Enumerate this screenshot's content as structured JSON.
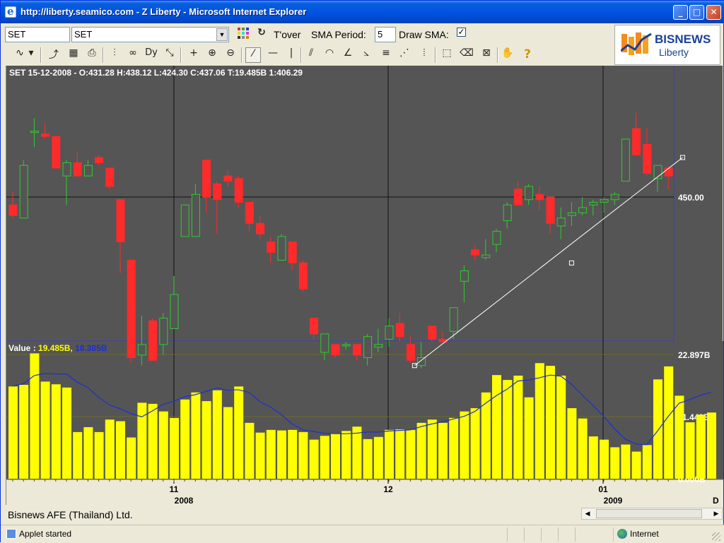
{
  "window": {
    "title": "http://liberty.seamico.com - Z Liberty - Microsoft Internet Explorer",
    "min_glyph": "_",
    "max_glyph": "□",
    "close_glyph": "✕"
  },
  "toolbar1": {
    "symbol_input": "SET",
    "symbol_select": "SET",
    "tover_label": "T'over",
    "sma_period_label": "SMA Period:",
    "sma_period_value": "5",
    "draw_sma_label": "Draw SMA:",
    "draw_sma_checked": "✓"
  },
  "toolbar2": {
    "icons": [
      {
        "name": "line-chart-icon",
        "glyph": "∿"
      },
      {
        "name": "chart-type-dropdown-icon",
        "glyph": "▾"
      },
      {
        "name": "export-icon",
        "glyph": "⤴"
      },
      {
        "name": "save-icon",
        "glyph": "▦"
      },
      {
        "name": "print-icon",
        "glyph": "⎙"
      },
      {
        "name": "indicator-icon",
        "glyph": "⫶"
      },
      {
        "name": "period-icon",
        "glyph": "∞"
      },
      {
        "name": "dy-icon",
        "glyph": "Dy"
      },
      {
        "name": "resize-icon",
        "glyph": "⤡"
      },
      {
        "name": "crosshair-icon",
        "glyph": "+"
      },
      {
        "name": "zoom-in-icon",
        "glyph": "⊕"
      },
      {
        "name": "zoom-out-icon",
        "glyph": "⊖"
      },
      {
        "name": "trend-line-icon",
        "glyph": "⁄"
      },
      {
        "name": "horizontal-line-icon",
        "glyph": "—"
      },
      {
        "name": "vertical-line-icon",
        "glyph": "|"
      },
      {
        "name": "channel-icon",
        "glyph": "⫽"
      },
      {
        "name": "arc-icon",
        "glyph": "◠"
      },
      {
        "name": "fan-icon",
        "glyph": "∠"
      },
      {
        "name": "speed-line-icon",
        "glyph": "⦣"
      },
      {
        "name": "fibonacci-icon",
        "glyph": "≡"
      },
      {
        "name": "gann-fan-icon",
        "glyph": "⋰"
      },
      {
        "name": "cycle-icon",
        "glyph": "⦙"
      },
      {
        "name": "select-icon",
        "glyph": "⬚"
      },
      {
        "name": "delete-icon",
        "glyph": "⌫"
      },
      {
        "name": "delete-all-icon",
        "glyph": "⊠"
      },
      {
        "name": "pan-hand-icon",
        "glyph": "✋"
      },
      {
        "name": "help-icon",
        "glyph": "?"
      }
    ]
  },
  "logo": {
    "text_main": "BISNEWS",
    "text_sub": "Liberty"
  },
  "chart": {
    "ohlc_label": "SET 15-12-2008 - O:431.28 H:438.12 L:424.30 C:437.06 T:19.485B 1:406.29",
    "price_axis_label": "450.00",
    "volume_label_prefix": "Value : ",
    "volume_value_1": "19.485B,",
    "volume_value_2": "18.385B",
    "volume_ticks": [
      "22.897B",
      "11.449B",
      "0.000B"
    ],
    "x_ticks": [
      {
        "month": "11",
        "year": "2008"
      },
      {
        "month": "12",
        "year": ""
      },
      {
        "month": "01",
        "year": "2009"
      }
    ],
    "x_axis_end_label": "D"
  },
  "chart_data": {
    "type": "candlestick",
    "title": "SET",
    "price_series": [
      {
        "o": 447,
        "h": 452,
        "l": 442,
        "c": 443
      },
      {
        "o": 442,
        "h": 464,
        "l": 442,
        "c": 462
      },
      {
        "o": 475,
        "h": 480,
        "l": 469,
        "c": 475
      },
      {
        "o": 474,
        "h": 478,
        "l": 472,
        "c": 473
      },
      {
        "o": 473,
        "h": 473,
        "l": 461,
        "c": 461
      },
      {
        "o": 458,
        "h": 464,
        "l": 447,
        "c": 463
      },
      {
        "o": 463,
        "h": 467,
        "l": 458,
        "c": 458
      },
      {
        "o": 458,
        "h": 464,
        "l": 458,
        "c": 462
      },
      {
        "o": 465,
        "h": 466,
        "l": 462,
        "c": 463
      },
      {
        "o": 461,
        "h": 461,
        "l": 453,
        "c": 454
      },
      {
        "o": 449,
        "h": 449,
        "l": 421,
        "c": 433
      },
      {
        "o": 426,
        "h": 426,
        "l": 387,
        "c": 389
      },
      {
        "o": 390,
        "h": 405,
        "l": 386,
        "c": 394
      },
      {
        "o": 403,
        "h": 404,
        "l": 388,
        "c": 388
      },
      {
        "o": 394,
        "h": 406,
        "l": 390,
        "c": 404
      },
      {
        "o": 400,
        "h": 420,
        "l": 400,
        "c": 413
      },
      {
        "o": 435,
        "h": 444,
        "l": 435,
        "c": 447
      },
      {
        "o": 435,
        "h": 455,
        "l": 435,
        "c": 451
      },
      {
        "o": 464,
        "h": 464,
        "l": 444,
        "c": 450
      },
      {
        "o": 455,
        "h": 456,
        "l": 436,
        "c": 449
      },
      {
        "o": 458,
        "h": 460,
        "l": 454,
        "c": 456
      },
      {
        "o": 457,
        "h": 458,
        "l": 446,
        "c": 448
      },
      {
        "o": 448,
        "h": 448,
        "l": 437,
        "c": 440
      },
      {
        "o": 440,
        "h": 443,
        "l": 434,
        "c": 436
      },
      {
        "o": 433,
        "h": 435,
        "l": 425,
        "c": 429
      },
      {
        "o": 426,
        "h": 436,
        "l": 426,
        "c": 435
      },
      {
        "o": 433,
        "h": 433,
        "l": 422,
        "c": 425
      },
      {
        "o": 425,
        "h": 426,
        "l": 414,
        "c": 415
      },
      {
        "o": 404,
        "h": 404,
        "l": 396,
        "c": 398
      },
      {
        "o": 391,
        "h": 398,
        "l": 388,
        "c": 398
      },
      {
        "o": 394,
        "h": 394,
        "l": 389,
        "c": 390
      },
      {
        "o": 394,
        "h": 395,
        "l": 392,
        "c": 394
      },
      {
        "o": 394,
        "h": 394,
        "l": 388,
        "c": 390
      },
      {
        "o": 389,
        "h": 398,
        "l": 386,
        "c": 397
      },
      {
        "o": 393,
        "h": 400,
        "l": 391,
        "c": 394
      },
      {
        "o": 396,
        "h": 404,
        "l": 393,
        "c": 401
      },
      {
        "o": 402,
        "h": 406,
        "l": 395,
        "c": 397
      },
      {
        "o": 394,
        "h": 397,
        "l": 387,
        "c": 388
      },
      {
        "o": 386,
        "h": 395,
        "l": 385,
        "c": 389
      },
      {
        "o": 401,
        "h": 401,
        "l": 395,
        "c": 396
      },
      {
        "o": 396,
        "h": 399,
        "l": 395,
        "c": 395
      },
      {
        "o": 399,
        "h": 408,
        "l": 396,
        "c": 408
      },
      {
        "o": 418,
        "h": 424,
        "l": 410,
        "c": 422
      },
      {
        "o": 430,
        "h": 432,
        "l": 426,
        "c": 428
      },
      {
        "o": 427,
        "h": 434,
        "l": 426,
        "c": 428
      },
      {
        "o": 432,
        "h": 438,
        "l": 429,
        "c": 437
      },
      {
        "o": 441,
        "h": 448,
        "l": 438,
        "c": 447
      },
      {
        "o": 453,
        "h": 456,
        "l": 447,
        "c": 447
      },
      {
        "o": 449,
        "h": 455,
        "l": 447,
        "c": 454
      },
      {
        "o": 451,
        "h": 454,
        "l": 445,
        "c": 449
      },
      {
        "o": 450,
        "h": 450,
        "l": 436,
        "c": 440
      },
      {
        "o": 439,
        "h": 446,
        "l": 434,
        "c": 442
      },
      {
        "o": 443,
        "h": 448,
        "l": 439,
        "c": 444
      },
      {
        "o": 444,
        "h": 450,
        "l": 443,
        "c": 446
      },
      {
        "o": 447,
        "h": 449,
        "l": 443,
        "c": 448
      },
      {
        "o": 448,
        "h": 450,
        "l": 444,
        "c": 449
      },
      {
        "o": 449,
        "h": 452,
        "l": 447,
        "c": 451
      },
      {
        "o": 456,
        "h": 472,
        "l": 456,
        "c": 472
      },
      {
        "o": 476,
        "h": 482,
        "l": 469,
        "c": 466
      },
      {
        "o": 470,
        "h": 476,
        "l": 458,
        "c": 459
      },
      {
        "o": 457,
        "h": 462,
        "l": 452,
        "c": 462
      },
      {
        "o": 461,
        "h": 462,
        "l": 453,
        "c": 458
      }
    ],
    "volume_series": {
      "name": "Value",
      "values": [
        17.0,
        17.3,
        23.1,
        17.9,
        17.4,
        16.8,
        8.6,
        9.5,
        8.6,
        10.9,
        10.6,
        7.6,
        14.0,
        13.8,
        12.4,
        11.2,
        14.6,
        15.9,
        14.3,
        16.3,
        13.2,
        17.0,
        10.3,
        8.5,
        9.0,
        8.9,
        9.0,
        8.6,
        7.2,
        7.9,
        8.3,
        8.8,
        9.6,
        7.3,
        7.7,
        9.0,
        9.1,
        9.0,
        10.3,
        10.9,
        10.3,
        11.2,
        12.4,
        13.0,
        15.9,
        19.1,
        18.2,
        19.0,
        15.0,
        21.3,
        20.8,
        19.0,
        13.0,
        11.1,
        7.8,
        7.2,
        5.8,
        6.3,
        5.0,
        6.2,
        18.3,
        20.7,
        15.3,
        10.4,
        11.8,
        12.2
      ]
    },
    "sma_series": {
      "values": [
        17.1,
        17.5,
        19.0,
        19.4,
        19.3,
        19.3,
        17.8,
        16.8,
        15.0,
        13.6,
        12.9,
        12.0,
        11.4,
        12.5,
        13.7,
        14.3,
        15.1,
        15.5,
        16.1,
        16.7,
        16.3,
        16.4,
        15.9,
        14.2,
        13.2,
        11.8,
        10.1,
        9.0,
        8.7,
        8.4,
        8.3,
        8.3,
        8.4,
        8.6,
        8.6,
        8.8,
        8.9,
        9.0,
        9.6,
        10.1,
        10.5,
        11.0,
        11.5,
        12.4,
        13.9,
        15.3,
        16.5,
        18.0,
        18.2,
        18.6,
        19.1,
        18.9,
        17.4,
        15.4,
        13.5,
        11.5,
        9.2,
        7.3,
        6.4,
        6.3,
        8.8,
        11.5,
        13.9,
        14.6,
        15.4,
        15.9
      ]
    },
    "ylim_volume": [
      0,
      22.897
    ],
    "volume_ticks": [
      0,
      11.449,
      22.897
    ],
    "price_ref_line": 450.0,
    "trend_line": [
      {
        "x_index": 37,
        "y": 386
      },
      {
        "x_index": 62,
        "y": 465
      }
    ],
    "x_ticks": [
      "11 2008",
      "12",
      "01 2009"
    ],
    "grid": true
  }
}
